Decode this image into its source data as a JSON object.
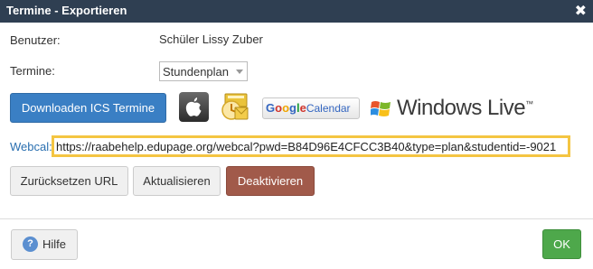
{
  "dialog": {
    "title": "Termine - Exportieren",
    "close_glyph": "✖"
  },
  "form": {
    "user_label": "Benutzer:",
    "user_value": "Schüler Lissy Zuber",
    "dates_label": "Termine:",
    "dates_select_value": "Stundenplan"
  },
  "export": {
    "download_label": "Downloaden ICS Termine",
    "apple_icon": "apple-icon",
    "outlook_icon": "outlook-icon",
    "google_calendar": {
      "google": [
        "G",
        "o",
        "o",
        "g",
        "l",
        "e"
      ],
      "calendar": "Calendar"
    },
    "windows_live": "Windows Live",
    "windows_live_mark": "™"
  },
  "webcal": {
    "label": "Webcal:",
    "url": "https://raabehelp.edupage.org/webcal?pwd=B84D96E4CFCC3B40&type=plan&studentid=-9021"
  },
  "actions": {
    "reset_url": "Zurücksetzen URL",
    "refresh": "Aktualisieren",
    "deactivate": "Deaktivieren"
  },
  "footer": {
    "help_icon_glyph": "?",
    "help_label": "Hilfe",
    "ok_label": "OK"
  },
  "colors": {
    "titlebar": "#2f3f52",
    "primary": "#3a7fc4",
    "danger": "#a15a4a",
    "success": "#4ea84b",
    "highlight": "#f4c542",
    "link": "#2a6fb0"
  }
}
